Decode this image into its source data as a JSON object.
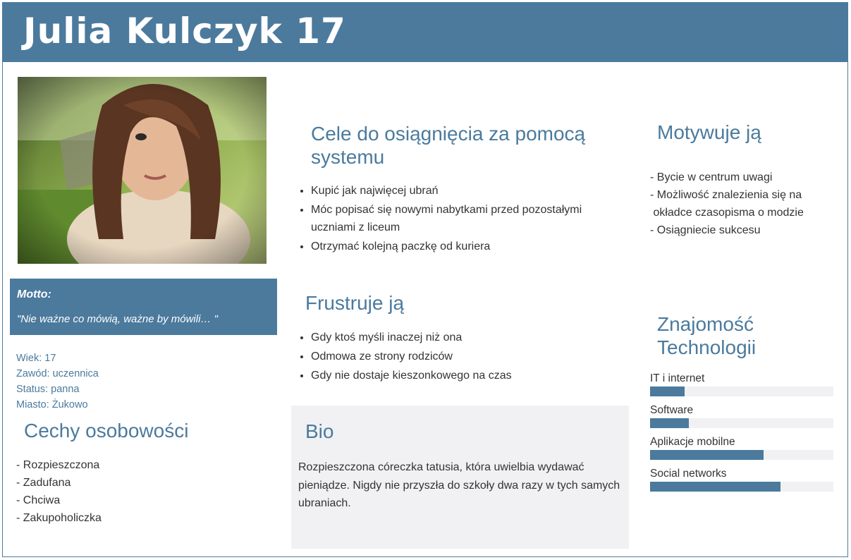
{
  "header": {
    "title": "Julia Kulczyk 17"
  },
  "motto": {
    "label": "Motto:",
    "text": "\"Nie ważne co mówią, ważne by mówili… \""
  },
  "facts": [
    "Wiek: 17",
    "Zawód: uczennica",
    "Status: panna",
    "Miasto: Żukowo"
  ],
  "traits": {
    "title": "Cechy osobowości",
    "items": [
      "- Rozpieszczona",
      "- Zadufana",
      "- Chciwa",
      "- Zakupoholiczka"
    ]
  },
  "goals": {
    "title": "Cele do osiągnięcia za pomocą systemu",
    "items": [
      "Kupić jak najwięcej ubrań",
      "Móc popisać się nowymi nabytkami przed pozostałymi uczniami z liceum",
      "Otrzymać kolejną paczkę od kuriera"
    ]
  },
  "frustrations": {
    "title": "Frustruje ją",
    "items": [
      "Gdy ktoś myśli inaczej niż ona",
      "Odmowa ze strony rodziców",
      "Gdy nie dostaje kieszonkowego na czas"
    ]
  },
  "bio": {
    "title": "Bio",
    "text": "Rozpieszczona córeczka tatusia, która uwielbia wydawać pieniądze. Nigdy nie przyszła do szkoły dwa razy w tych samych ubraniach."
  },
  "motivation": {
    "title": "Motywuje ją",
    "items": [
      "- Bycie w centrum uwagi",
      "- Możliwość znalezienia się na",
      " okładce czasopisma o modzie",
      "- Osiągniecie sukcesu"
    ]
  },
  "tech": {
    "title": "Znajomość Technologii",
    "skills": [
      {
        "name": "IT i internet",
        "level": 0.19
      },
      {
        "name": "Software",
        "level": 0.21
      },
      {
        "name": "Aplikacje mobilne",
        "level": 0.62
      },
      {
        "name": "Social networks",
        "level": 0.71
      }
    ]
  },
  "colors": {
    "accent": "#4b7a9d",
    "panel": "#f1f1f3",
    "text": "#333333"
  }
}
